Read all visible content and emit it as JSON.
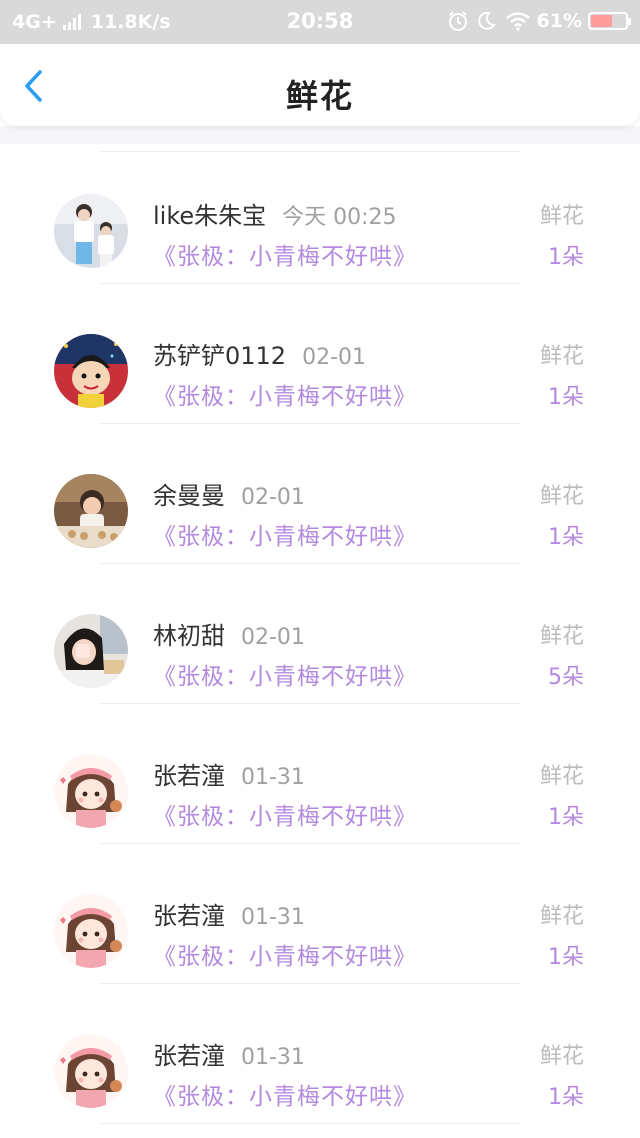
{
  "status_bar": {
    "network": "4G+",
    "speed": "11.8K/s",
    "time": "20:58",
    "battery_percent": "61%",
    "battery_level": 0.61
  },
  "nav": {
    "title": "鲜花"
  },
  "colors": {
    "accent": "#b48ae0",
    "back_arrow": "#2a9df4",
    "status_bar_bg": "#d9d9d9"
  },
  "items": [
    {
      "name": "like朱朱宝",
      "time": "今天 00:25",
      "book": "《张极：小青梅不好哄》",
      "gift": "鲜花",
      "count": "1朵",
      "avatar": "photo-boys-avatar"
    },
    {
      "name": "苏铲铲0112",
      "time": "02-01",
      "book": "《张极：小青梅不好哄》",
      "gift": "鲜花",
      "count": "1朵",
      "avatar": "cartoon-boy-avatar"
    },
    {
      "name": "余曼曼",
      "time": "02-01",
      "book": "《张极：小青梅不好哄》",
      "gift": "鲜花",
      "count": "1朵",
      "avatar": "photo-child-avatar"
    },
    {
      "name": "林初甜",
      "time": "02-01",
      "book": "《张极：小青梅不好哄》",
      "gift": "鲜花",
      "count": "5朵",
      "avatar": "photo-girl-avatar"
    },
    {
      "name": "张若潼",
      "time": "01-31",
      "book": "《张极：小青梅不好哄》",
      "gift": "鲜花",
      "count": "1朵",
      "avatar": "cartoon-girl-avatar"
    },
    {
      "name": "张若潼",
      "time": "01-31",
      "book": "《张极：小青梅不好哄》",
      "gift": "鲜花",
      "count": "1朵",
      "avatar": "cartoon-girl-avatar"
    },
    {
      "name": "张若潼",
      "time": "01-31",
      "book": "《张极：小青梅不好哄》",
      "gift": "鲜花",
      "count": "1朵",
      "avatar": "cartoon-girl-avatar"
    }
  ]
}
